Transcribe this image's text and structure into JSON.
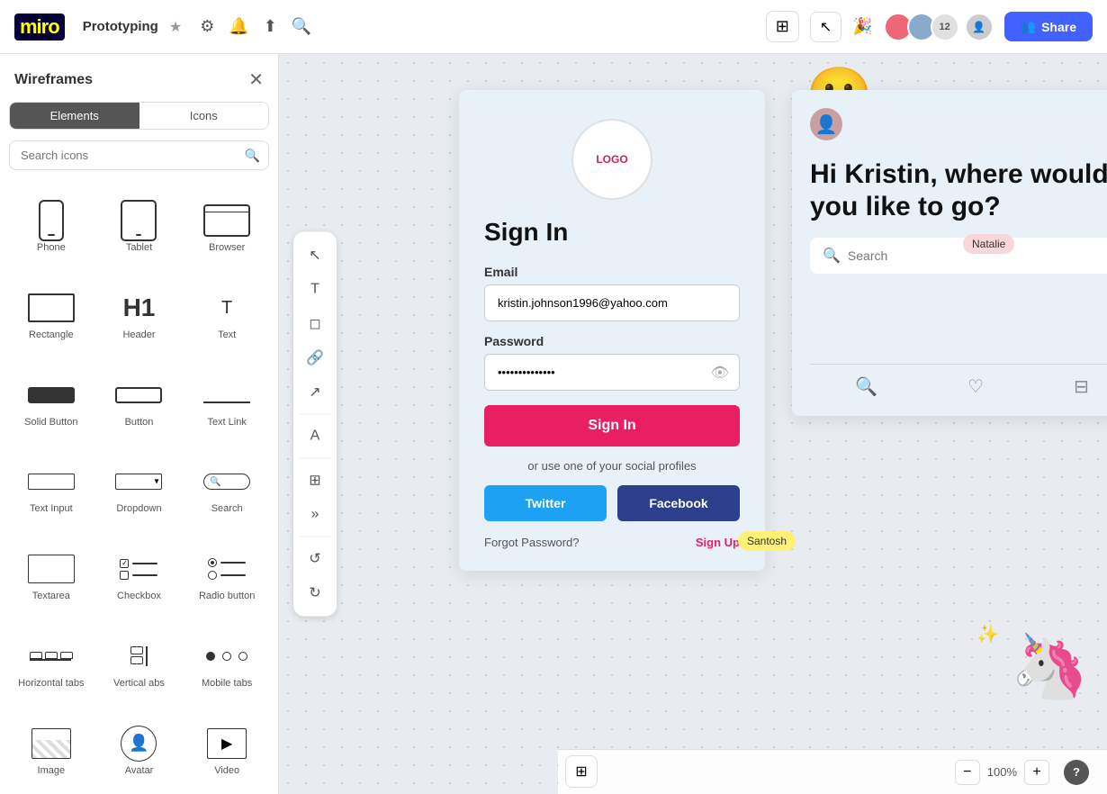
{
  "topbar": {
    "logo": "miro",
    "project_name": "Prototyping",
    "share_label": "Share",
    "avatar_count": "12",
    "zoom_level": "100%"
  },
  "left_panel": {
    "title": "Wireframes",
    "tabs": [
      {
        "label": "Elements",
        "active": true
      },
      {
        "label": "Icons",
        "active": false
      }
    ],
    "search_placeholder": "Search icons",
    "elements": [
      {
        "id": "phone",
        "label": "Phone"
      },
      {
        "id": "tablet",
        "label": "Tablet"
      },
      {
        "id": "browser",
        "label": "Browser"
      },
      {
        "id": "rectangle",
        "label": "Rectangle"
      },
      {
        "id": "header",
        "label": "Header"
      },
      {
        "id": "text",
        "label": "Text"
      },
      {
        "id": "solid-button",
        "label": "Solid Button"
      },
      {
        "id": "button",
        "label": "Button"
      },
      {
        "id": "text-link",
        "label": "Text Link"
      },
      {
        "id": "text-input",
        "label": "Text Input"
      },
      {
        "id": "dropdown",
        "label": "Dropdown"
      },
      {
        "id": "search",
        "label": "Search"
      },
      {
        "id": "textarea",
        "label": "Textarea"
      },
      {
        "id": "checkbox",
        "label": "Checkbox"
      },
      {
        "id": "radio-button",
        "label": "Radio button"
      },
      {
        "id": "horizontal-tabs",
        "label": "Horizontal tabs"
      },
      {
        "id": "vertical-tabs",
        "label": "Vertical abs"
      },
      {
        "id": "mobile-tabs",
        "label": "Mobile tabs"
      },
      {
        "id": "image",
        "label": "Image"
      },
      {
        "id": "avatar",
        "label": "Avatar"
      },
      {
        "id": "video",
        "label": "Video"
      }
    ]
  },
  "toolbar": {
    "tools": [
      "cursor",
      "text",
      "sticky-note",
      "connector",
      "scale",
      "font",
      "frame",
      "more"
    ]
  },
  "signin_wireframe": {
    "logo_text": "LOGO",
    "title": "Sign In",
    "email_label": "Email",
    "email_value": "kristin.johnson1996@yahoo.com",
    "password_label": "Password",
    "password_value": "••••••••••••••",
    "signin_btn": "Sign In",
    "or_text": "or use one of your social profiles",
    "twitter_btn": "Twitter",
    "facebook_btn": "Facebook",
    "forgot_label": "Forgot Password?",
    "signup_label": "Sign Up"
  },
  "nav_wireframe": {
    "greeting": "Hi Kristin, where would you like to go?",
    "search_placeholder": "Search",
    "natalie_badge": "Natalie",
    "santosh_badge": "Santosh"
  },
  "bottom": {
    "zoom_minus": "−",
    "zoom_level": "100%",
    "zoom_plus": "+",
    "help": "?"
  }
}
